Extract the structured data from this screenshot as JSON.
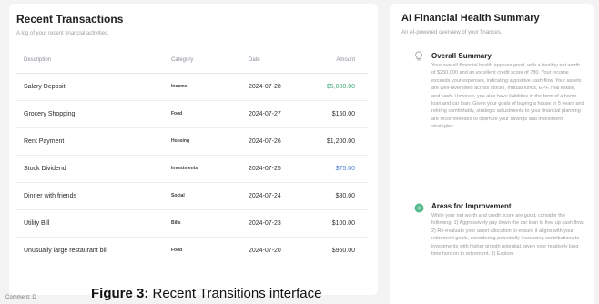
{
  "transactions": {
    "title": "Recent Transactions",
    "subtitle": "A log of your recent financial activities.",
    "columns": {
      "description": "Description",
      "category": "Category",
      "date": "Date",
      "amount": "Amount"
    },
    "rows": [
      {
        "description": "Salary Deposit",
        "category": "Income",
        "date": "2024-07-28",
        "amount": "$5,000.00",
        "amount_color": "green"
      },
      {
        "description": "Grocery Shopping",
        "category": "Food",
        "date": "2024-07-27",
        "amount": "$150.00",
        "amount_color": "default"
      },
      {
        "description": "Rent Payment",
        "category": "Housing",
        "date": "2024-07-26",
        "amount": "$1,200.00",
        "amount_color": "default"
      },
      {
        "description": "Stock Dividend",
        "category": "Investments",
        "date": "2024-07-25",
        "amount": "$75.00",
        "amount_color": "blue"
      },
      {
        "description": "Dinner with friends",
        "category": "Social",
        "date": "2024-07-24",
        "amount": "$80.00",
        "amount_color": "default"
      },
      {
        "description": "Utility Bill",
        "category": "Bills",
        "date": "2024-07-23",
        "amount": "$100.00",
        "amount_color": "default"
      },
      {
        "description": "Unusually large restaurant bill",
        "category": "Food",
        "date": "2024-07-20",
        "amount": "$950.00",
        "amount_color": "default"
      }
    ]
  },
  "summary": {
    "title": "AI Financial Health Summary",
    "subtitle": "An AI-powered overview of your finances.",
    "sections": [
      {
        "icon": "lightbulb-icon",
        "title": "Overall Summary",
        "text": "Your overall financial health appears good, with a healthy net worth of $250,000 and an excellent credit score of 780. Your income exceeds your expenses, indicating a positive cash flow. Your assets are well-diversified across stocks, mutual funds, EPF, real estate, and cash. However, you also have liabilities in the form of a home loan and car loan. Given your goals of buying a house in 5 years and retiring comfortably, strategic adjustments to your financial planning are recommended to optimize your savings and investment strategies."
      },
      {
        "icon": "target-icon",
        "title": "Areas for Improvement",
        "text": "While your net worth and credit score are good, consider the following: 1) Aggressively pay down the car loan to free up cash flow. 2) Re-evaluate your asset allocation to ensure it aligns with your retirement goals, considering potentially increasing contributions to investments with higher growth potential, given your relatively long time horizon to retirement. 3) Explore"
      }
    ]
  },
  "caption": {
    "label": "Figure 3:",
    "text": " Recent Transitions interface"
  },
  "cropped_text": "Comment: D"
}
